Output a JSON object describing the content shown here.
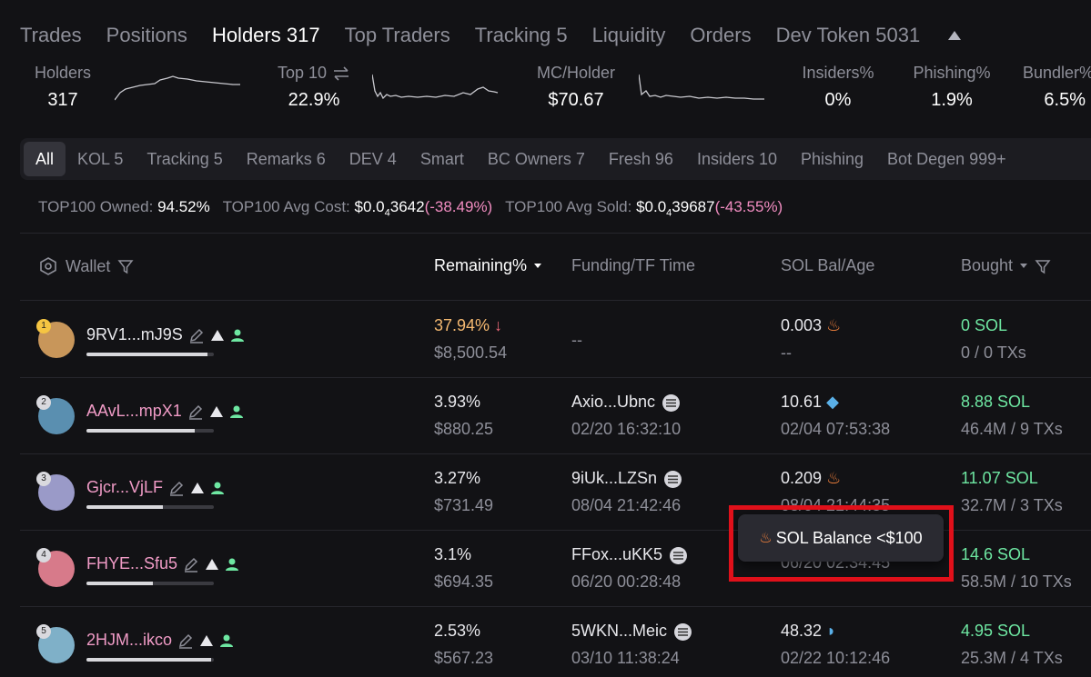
{
  "tabs": [
    {
      "label": "Trades",
      "active": false
    },
    {
      "label": "Positions",
      "active": false
    },
    {
      "label": "Holders 317",
      "active": true
    },
    {
      "label": "Top Traders",
      "active": false
    },
    {
      "label": "Tracking 5",
      "active": false
    },
    {
      "label": "Liquidity",
      "active": false
    },
    {
      "label": "Orders",
      "active": false
    },
    {
      "label": "Dev Token 5031",
      "active": false
    }
  ],
  "stats": {
    "holders": {
      "label": "Holders",
      "value": "317"
    },
    "top10": {
      "label": "Top 10",
      "value": "22.9%"
    },
    "mc_holder": {
      "label": "MC/Holder",
      "value": "$70.67"
    },
    "insiders": {
      "label": "Insiders%",
      "value": "0%"
    },
    "phishing": {
      "label": "Phishing%",
      "value": "1.9%"
    },
    "bundler": {
      "label": "Bundler%",
      "value": "6.5%"
    }
  },
  "chips": [
    {
      "label": "All",
      "active": true
    },
    {
      "label": "KOL 5"
    },
    {
      "label": "Tracking 5"
    },
    {
      "label": "Remarks 6"
    },
    {
      "label": "DEV 4"
    },
    {
      "label": "Smart"
    },
    {
      "label": "BC Owners 7"
    },
    {
      "label": "Fresh 96"
    },
    {
      "label": "Insiders 10"
    },
    {
      "label": "Phishing"
    },
    {
      "label": "Bot Degen 999+"
    }
  ],
  "summary": {
    "owned_label": "TOP100 Owned:",
    "owned_value": "94.52%",
    "avg_cost_label": "TOP100 Avg Cost:",
    "avg_cost_prefix": "$0.0",
    "avg_cost_sub": "4",
    "avg_cost_digits": "3642",
    "avg_cost_change": "(-38.49%)",
    "avg_sold_label": "TOP100 Avg Sold:",
    "avg_sold_prefix": "$0.0",
    "avg_sold_sub": "4",
    "avg_sold_digits": "39687",
    "avg_sold_change": "(-43.55%)"
  },
  "columns": {
    "wallet": "Wallet",
    "remaining": "Remaining%",
    "funding": "Funding/TF Time",
    "sol_bal": "SOL Bal/Age",
    "bought": "Bought"
  },
  "rows": [
    {
      "rank": "1",
      "wallet": "9RV1...mJ9S",
      "remaining_pct": "37.94%",
      "remaining_usd": "$8,500.54",
      "funding": "--",
      "funding_time": "",
      "sol_bal": "0.003",
      "sol_age": "--",
      "bought_sol": "0 SOL",
      "bought_txs": "0 / 0 TXs",
      "remaining_fill": 0.95,
      "wallet_color": "#e8e8ec",
      "avatar_color": "#c8965a",
      "sol_icon": "fire-icon"
    },
    {
      "rank": "2",
      "wallet": "AAvL...mpX1",
      "remaining_pct": "3.93%",
      "remaining_usd": "$880.25",
      "funding": "Axio...Ubnc",
      "funding_time": "02/20 16:32:10",
      "sol_bal": "10.61",
      "sol_age": "02/04 07:53:38",
      "bought_sol": "8.88 SOL",
      "bought_txs": "46.4M / 9 TXs",
      "remaining_fill": 0.85,
      "wallet_color": "#f09bc6",
      "avatar_color": "#5a8fb0",
      "sol_icon": "fish-icon"
    },
    {
      "rank": "3",
      "wallet": "Gjcr...VjLF",
      "remaining_pct": "3.27%",
      "remaining_usd": "$731.49",
      "funding": "9iUk...LZSn",
      "funding_time": "08/04 21:42:46",
      "sol_bal": "0.209",
      "sol_age": "08/04 21:44:35",
      "bought_sol": "11.07 SOL",
      "bought_txs": "32.7M / 3 TXs",
      "remaining_fill": 0.6,
      "wallet_color": "#f09bc6",
      "avatar_color": "#9a9ac8",
      "sol_icon": "fire-icon"
    },
    {
      "rank": "4",
      "wallet": "FHYE...Sfu5",
      "remaining_pct": "3.1%",
      "remaining_usd": "$694.35",
      "funding": "FFox...uKK5",
      "funding_time": "06/20 00:28:48",
      "sol_bal": "",
      "sol_age": "06/20 02:34:45",
      "bought_sol": "14.6 SOL",
      "bought_txs": "58.5M / 10 TXs",
      "remaining_fill": 0.52,
      "wallet_color": "#f09bc6",
      "avatar_color": "#d77a8a",
      "sol_icon": ""
    },
    {
      "rank": "5",
      "wallet": "2HJM...ikco",
      "remaining_pct": "2.53%",
      "remaining_usd": "$567.23",
      "funding": "5WKN...Meic",
      "funding_time": "03/10 11:38:24",
      "sol_bal": "48.32",
      "sol_age": "02/22 10:12:46",
      "bought_sol": "4.95 SOL",
      "bought_txs": "25.3M / 4 TXs",
      "remaining_fill": 0.98,
      "wallet_color": "#f09bc6",
      "avatar_color": "#7fb0c8",
      "sol_icon": "dolphin-icon"
    }
  ],
  "tooltip": {
    "text": "SOL Balance <$100",
    "icon": "fire-icon"
  },
  "colors": {
    "green": "#6ee7a2",
    "orange": "#f5b971",
    "pink": "#f09bc6",
    "highlight": "#e0101a"
  }
}
